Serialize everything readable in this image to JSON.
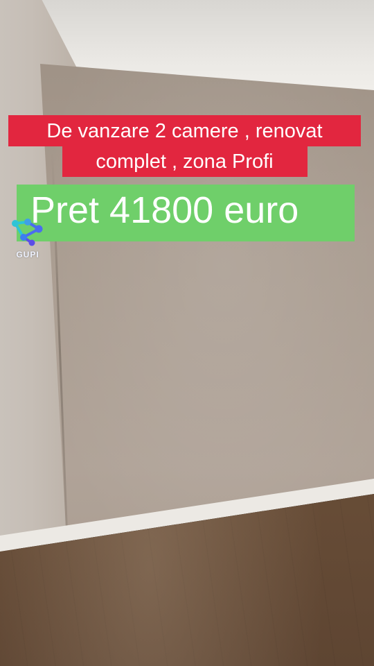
{
  "overlay": {
    "line1": "De vanzare 2 camere , renovat",
    "line2": "complet , zona Profi",
    "price": "Pret 41800 euro"
  },
  "watermark": {
    "icon": "network-nodes-icon",
    "text": "GUPI"
  },
  "colors": {
    "red_caption": "#e2263f",
    "green_caption": "#6fcf6a",
    "logo_blue": "#4a6cf0",
    "logo_teal": "#2ec4d6"
  }
}
